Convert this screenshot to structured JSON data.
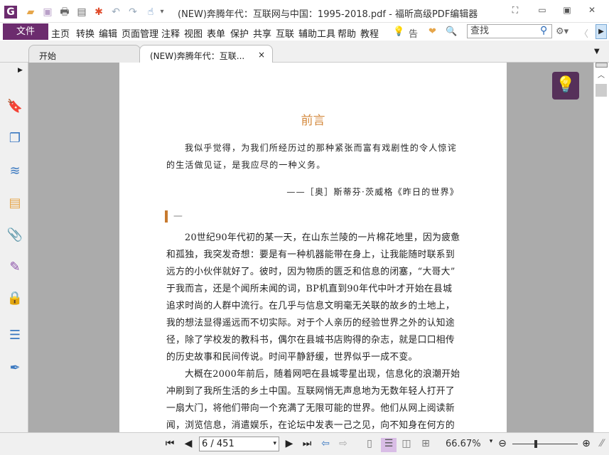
{
  "window": {
    "title": "(NEW)奔腾年代：互联网与中国：1995-2018.pdf - 福昕高级PDF编辑器"
  },
  "quick_access": [
    {
      "icon": "app-logo-icon",
      "glyph": "G"
    },
    {
      "icon": "open-folder-icon",
      "glyph": "📂"
    },
    {
      "icon": "save-icon",
      "glyph": "💾"
    },
    {
      "icon": "print-icon",
      "glyph": "🖶"
    },
    {
      "icon": "form-icon",
      "glyph": "▤"
    },
    {
      "icon": "new-icon",
      "glyph": "✱"
    },
    {
      "icon": "undo-icon",
      "glyph": "↶"
    },
    {
      "icon": "redo-icon",
      "glyph": "↷"
    },
    {
      "icon": "hand-tool-icon",
      "glyph": "☝"
    },
    {
      "icon": "customize-dropdown-icon",
      "glyph": "▾"
    }
  ],
  "menu": {
    "file": "文件",
    "items": [
      "主页",
      "转换",
      "编辑",
      "页面管理",
      "注释",
      "视图",
      "表单",
      "保护",
      "共享",
      "互联",
      "辅助工具",
      "帮助",
      "教程"
    ],
    "tell_me": "告诉",
    "search_placeholder": "查找"
  },
  "tabs": [
    {
      "label": "开始"
    },
    {
      "label": "(NEW)奔腾年代：互联...",
      "close": "×"
    }
  ],
  "sidebar": [
    "bookmark-icon",
    "pages-icon",
    "layers-icon",
    "comments-icon",
    "attachments-icon",
    "signature-icon",
    "security-icon",
    "form-fields-icon",
    "certify-icon"
  ],
  "document": {
    "heading": "前言",
    "epigraph_lines": [
      "我似乎觉得，为我们所经历过的那种紧张而富有戏剧性的令人惊诧",
      "的生活做见证，是我应尽的一种义务。"
    ],
    "attribution": "——［奥］斯蒂芬·茨威格《昨日的世界》",
    "section_mark": "一",
    "body_lines": [
      "20世纪90年代初的某一天，在山东兰陵的一片棉花地里，因为疲惫",
      "和孤独，我突发奇想：要是有一种机器能带在身上，让我能随时联系到",
      "远方的小伙伴就好了。彼时，因为物质的匮乏和信息的闭塞，“大哥大”",
      "于我而言，还是个闻所未闻的词，BP机直到90年代中叶才开始在县城",
      "追求时尚的人群中流行。在几乎与信息文明毫无关联的故乡的土地上，",
      "我的想法显得遥远而不切实际。对于个人亲历的经验世界之外的认知途",
      "径，除了学校发的教科书，偶尔在县城书店购得的杂志，就是口口相传",
      "的历史故事和民间传说。时间平静舒缓，世界似乎一成不变。",
      "大概在2000年前后，随着网吧在县城零星出现，信息化的浪潮开始",
      "冲刷到了我所生活的乡土中国。互联网悄无声息地为无数年轻人打开了",
      "一扇大门，将他们带向一个充满了无限可能的世界。他们从网上阅读新",
      "闻，浏览信息，消遣娱乐，在论坛中发表一己之见，向不知身在何方的"
    ]
  },
  "status": {
    "page": "6 / 451",
    "zoom": "66.67%"
  },
  "colors": {
    "accent": "#6c2c6e",
    "heading": "#d48a3f",
    "bulb_bg": "#56305a"
  }
}
